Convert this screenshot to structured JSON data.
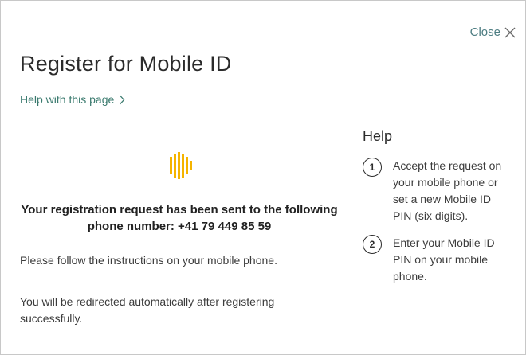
{
  "dialog": {
    "close_label": "Close",
    "title": "Register for Mobile ID",
    "help_link": "Help with this page"
  },
  "status": {
    "icon": "loading-bars-icon",
    "accent_color": "#f5b400",
    "message": "Your registration request has been sent to the following phone number: +41 79 449 85 59"
  },
  "instructions": [
    "Please follow the instructions on your mobile phone.",
    "You will be redirected automatically after registering successfully."
  ],
  "help": {
    "title": "Help",
    "steps": [
      {
        "number": "1",
        "text": "Accept the request on your mobile phone or set a new Mobile ID PIN (six digits)."
      },
      {
        "number": "2",
        "text": "Enter your Mobile ID PIN on your mobile phone."
      }
    ]
  }
}
